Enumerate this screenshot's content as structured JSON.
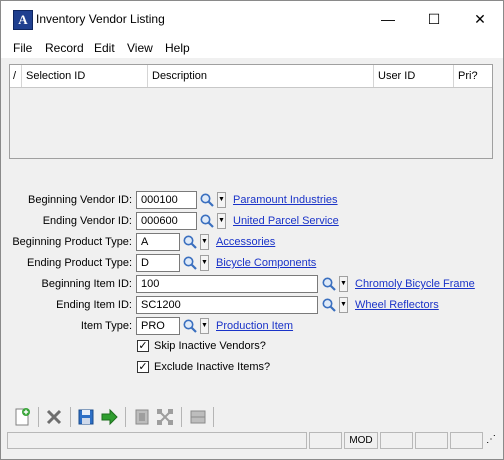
{
  "window": {
    "title": "Inventory Vendor Listing",
    "minimize": "—",
    "maximize": "☐",
    "close": "✕"
  },
  "menu": [
    "File",
    "Record",
    "Edit",
    "View",
    "Help"
  ],
  "grid": {
    "sort_glyph": "/",
    "columns": [
      "Selection ID",
      "Description",
      "User ID",
      "Pri?"
    ]
  },
  "form": {
    "beginning_vendor": {
      "label": "Beginning Vendor ID:",
      "value": "000100",
      "link": "Paramount Industries"
    },
    "ending_vendor": {
      "label": "Ending Vendor ID:",
      "value": "000600",
      "link": "United Parcel Service"
    },
    "beginning_product_type": {
      "label": "Beginning Product Type:",
      "value": "A",
      "link": "Accessories"
    },
    "ending_product_type": {
      "label": "Ending Product Type:",
      "value": "D",
      "link": "Bicycle Components"
    },
    "beginning_item": {
      "label": "Beginning Item ID:",
      "value": "100",
      "link": "Chromoly Bicycle Frame"
    },
    "ending_item": {
      "label": "Ending Item ID:",
      "value": "SC1200",
      "link": "Wheel Reflectors"
    },
    "item_type": {
      "label": "Item Type:",
      "value": "PRO",
      "link": "Production Item"
    },
    "skip_inactive_vendors": {
      "label": "Skip Inactive Vendors?",
      "checked": true,
      "mark": "✓"
    },
    "exclude_inactive_items": {
      "label": "Exclude Inactive Items?",
      "checked": true,
      "mark": "✓"
    }
  },
  "toolbar": [
    "new-icon",
    "delete-icon",
    "save-icon",
    "go-icon",
    "copy-icon",
    "move-icon",
    "list-icon"
  ],
  "status": {
    "mode": "MOD"
  },
  "colors": {
    "link": "#1a33c8",
    "app_icon": "#1f3f8f",
    "background": "#f0f0f0"
  }
}
